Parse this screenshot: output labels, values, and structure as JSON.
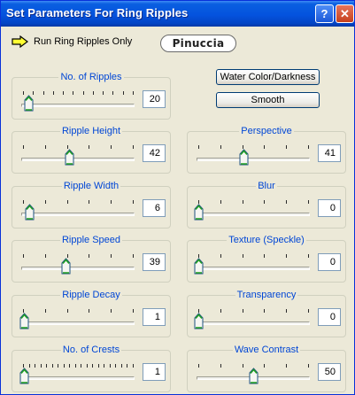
{
  "window": {
    "title": "Set Parameters For Ring Ripples",
    "help_label": "?",
    "close_label": "✕"
  },
  "run": {
    "label": "Run Ring Ripples Only",
    "icon": "arrow-right-icon"
  },
  "logo": "Pinuccia",
  "buttons": {
    "water": "Water Color/Darkness",
    "smooth": "Smooth"
  },
  "sliders": [
    {
      "label": "No. of Ripples",
      "value": "20",
      "ticks": 12,
      "level": 0.05
    },
    {
      "label": "Ripple Height",
      "value": "42",
      "ticks": 6,
      "level": 0.42
    },
    {
      "label": "Perspective",
      "value": "41",
      "ticks": 6,
      "level": 0.41
    },
    {
      "label": "Ripple Width",
      "value": "6",
      "ticks": 6,
      "level": 0.06
    },
    {
      "label": "Blur",
      "value": "0",
      "ticks": 6,
      "level": 0.0
    },
    {
      "label": "Ripple Speed",
      "value": "39",
      "ticks": 6,
      "level": 0.39
    },
    {
      "label": "Texture (Speckle)",
      "value": "0",
      "ticks": 6,
      "level": 0.0
    },
    {
      "label": "Ripple Decay",
      "value": "1",
      "ticks": 6,
      "level": 0.01
    },
    {
      "label": "Transparency",
      "value": "0",
      "ticks": 6,
      "level": 0.0
    },
    {
      "label": "No. of Crests",
      "value": "1",
      "ticks": 20,
      "level": 0.01
    },
    {
      "label": "Wave Contrast",
      "value": "50",
      "ticks": 6,
      "level": 0.5
    }
  ],
  "colors": {
    "title_bar": "#0453de",
    "label_blue": "#0046d5",
    "thumb_green": "#21a121",
    "face": "#ece9d8"
  }
}
